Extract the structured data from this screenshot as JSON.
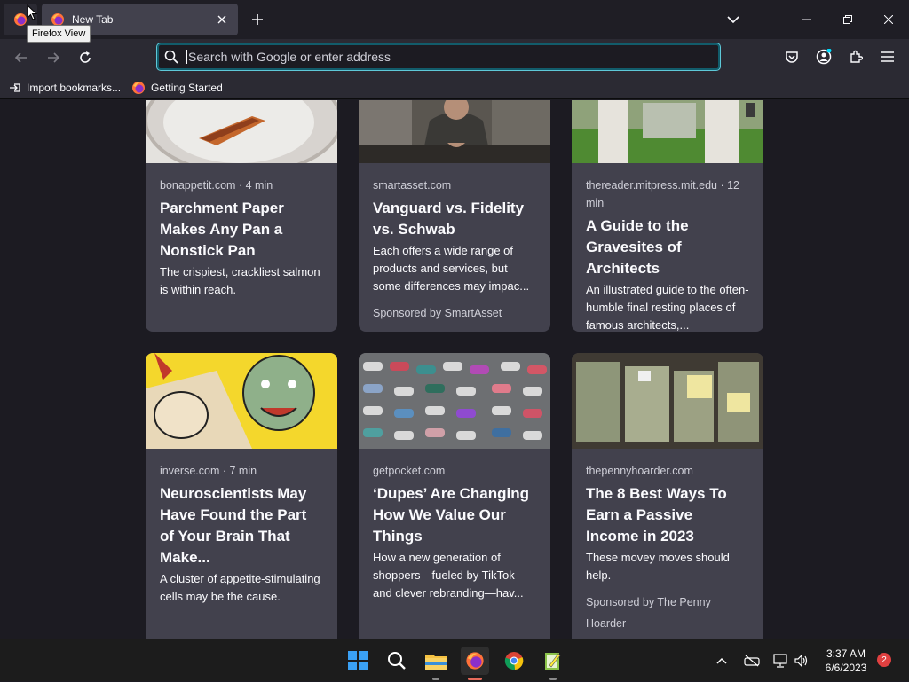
{
  "browser": {
    "tab_title": "New Tab",
    "tooltip": "Firefox View",
    "url_placeholder": "Search with Google or enter address"
  },
  "bookmarks": [
    {
      "label": "Import bookmarks..."
    },
    {
      "label": "Getting Started"
    }
  ],
  "cards": [
    {
      "source": "bonappetit.com · 4 min",
      "headline": "Parchment Paper Makes Any Pan a Nonstick Pan",
      "excerpt": "The crispiest, crackliest salmon is within reach.",
      "sponsor": ""
    },
    {
      "source": "smartasset.com",
      "headline": "Vanguard vs. Fidelity vs. Schwab",
      "excerpt": "Each offers a wide range of products and services, but some differences may impac...",
      "sponsor": "Sponsored by SmartAsset"
    },
    {
      "source": "thereader.mitpress.mit.edu · 12 min",
      "headline": "A Guide to the Gravesites of Architects",
      "excerpt": "An illustrated guide to the often-humble final resting places of famous architects,...",
      "sponsor": ""
    },
    {
      "source": "inverse.com · 7 min",
      "headline": "Neuroscientists May Have Found the Part of Your Brain That Make...",
      "excerpt": "A cluster of appetite-stimulating cells may be the cause.",
      "sponsor": ""
    },
    {
      "source": "getpocket.com",
      "headline": "‘Dupes’ Are Changing How We Value Our Things",
      "excerpt": "How a new generation of shoppers—fueled by TikTok and clever rebranding—hav...",
      "sponsor": ""
    },
    {
      "source": "thepennyhoarder.com",
      "headline": "The 8 Best Ways To Earn a Passive Income in 2023",
      "excerpt": "These movey moves should help.",
      "sponsor": "Sponsored by The Penny Hoarder"
    }
  ],
  "taskbar": {
    "time": "3:37 AM",
    "date": "6/6/2023",
    "notification_count": "2"
  },
  "colors": {
    "accent": "#00ddff",
    "card_bg": "#42414d",
    "page_bg": "#1c1b22"
  }
}
